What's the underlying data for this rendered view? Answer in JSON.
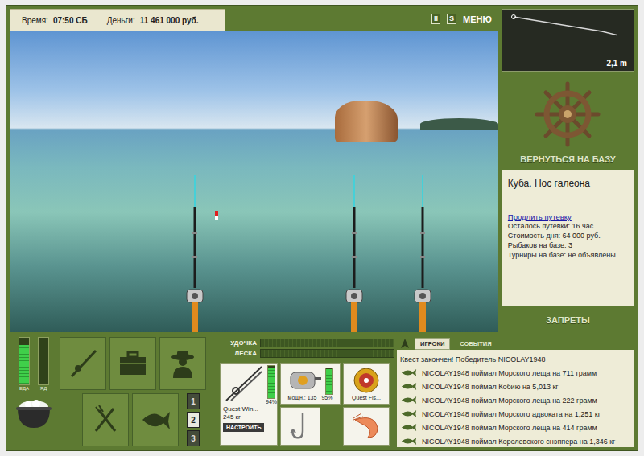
{
  "status_bar": {
    "time_label": "Время:",
    "time": "07:50 СБ",
    "money_label": "Деньги:",
    "money": "11 461 000 руб."
  },
  "top_controls": {
    "pause": "II",
    "sound": "S",
    "menu": "МЕНЮ"
  },
  "scene": {
    "rods": [
      {
        "float": true
      },
      {
        "float": false
      },
      {
        "float": false
      }
    ]
  },
  "depth_chart": {
    "values": [
      0.6,
      0.8,
      1.0,
      1.2,
      1.4,
      1.6,
      1.8,
      2.1
    ],
    "marker_index": 0,
    "reading": "2,1 m"
  },
  "base_panel": {
    "return_button": "ВЕРНУТЬСЯ НА БАЗУ",
    "location": "Куба. Нос галеона",
    "extend_link": "Продлить путевку",
    "lines": [
      "Осталось путевки: 16 час.",
      "Стоимость дня: 64 000 руб.",
      "Рыбаков на базе: 3",
      "Турниры на базе: не объявлены"
    ],
    "bans_button": "ЗАПРЕТЫ"
  },
  "needs": [
    {
      "label": "ЕДА",
      "level": 0.85
    },
    {
      "label": "ЯД",
      "level": 0
    }
  ],
  "pages": [
    {
      "label": "1",
      "selected": false
    },
    {
      "label": "2",
      "selected": true
    },
    {
      "label": "3",
      "selected": false
    }
  ],
  "gauges": [
    {
      "label": "УДОЧКА",
      "level": 0
    },
    {
      "label": "ЛЕСКА",
      "level": 0
    }
  ],
  "tackle": {
    "rod": {
      "name": "Quest Win...",
      "load": "245 кг",
      "wear": "94%",
      "level": 0.94,
      "button": "НАСТРОИТЬ"
    },
    "reel": {
      "power": "мощн.: 135",
      "wear": "95%",
      "level": 0.95
    },
    "line": {
      "name": "Quest Fis..."
    }
  },
  "feed": {
    "tabs": [
      {
        "label": "ИГРОКИ",
        "selected": true
      },
      {
        "label": "СОБЫТИЯ",
        "selected": false
      }
    ],
    "items": [
      {
        "kind": "notice",
        "text": "Квест закончен! Победитель NICOLAY1948"
      },
      {
        "kind": "catch",
        "text": "NICOLAY1948 поймал Морского леща на 711 грамм"
      },
      {
        "kind": "catch",
        "text": "NICOLAY1948 поймал Кобию на 5,013 кг"
      },
      {
        "kind": "catch",
        "text": "NICOLAY1948 поймал Морского леща на 222 грамм"
      },
      {
        "kind": "catch",
        "text": "NICOLAY1948 поймал Морского адвоката на 1,251 кг"
      },
      {
        "kind": "catch",
        "text": "NICOLAY1948 поймал Морского леща на 414 грамм"
      },
      {
        "kind": "catch",
        "text": "NICOLAY1948 поймал Королевского снэппера на 1,346 кг"
      }
    ]
  }
}
